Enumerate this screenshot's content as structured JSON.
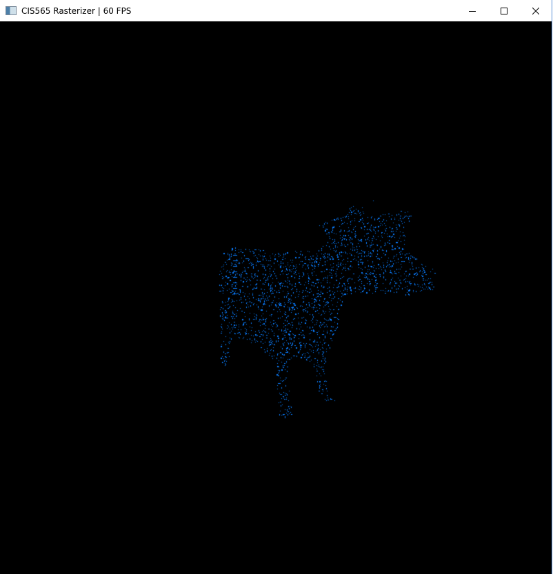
{
  "window": {
    "title": "CIS565 Rasterizer | 60 FPS",
    "controls": [
      "minimize",
      "maximize",
      "close"
    ]
  },
  "scene": {
    "background": "#000000",
    "point_color": "#0a7cff",
    "render_mode": "points",
    "model": "cow"
  }
}
